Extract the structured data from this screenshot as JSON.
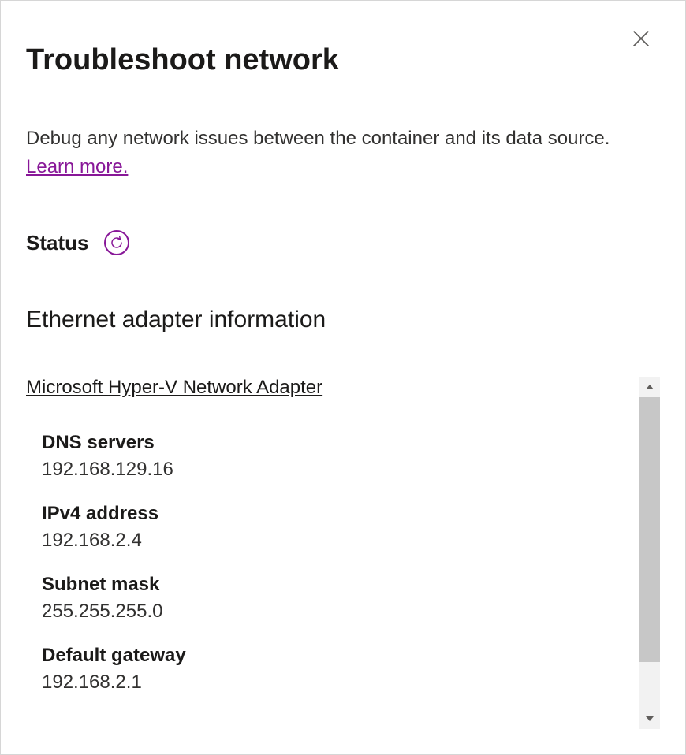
{
  "header": {
    "title": "Troubleshoot network",
    "description_text": "Debug any network issues between the container and its data source. ",
    "learn_more": "Learn more."
  },
  "status": {
    "label": "Status"
  },
  "adapter": {
    "section_title": "Ethernet adapter information",
    "name": "Microsoft Hyper-V Network Adapter",
    "properties": [
      {
        "label": "DNS servers",
        "value": "192.168.129.16"
      },
      {
        "label": "IPv4 address",
        "value": "192.168.2.4"
      },
      {
        "label": "Subnet mask",
        "value": "255.255.255.0"
      },
      {
        "label": "Default gateway",
        "value": "192.168.2.1"
      }
    ]
  }
}
